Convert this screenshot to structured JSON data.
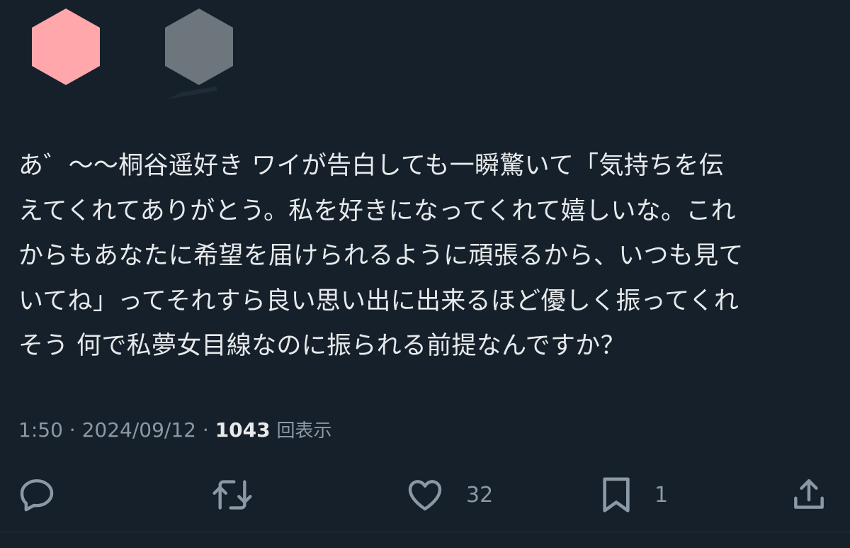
{
  "avatars": {
    "first_color": "#ffa7ab",
    "second_color": "#6e767d"
  },
  "tweet": {
    "lines": [
      "あ゛〜〜桐谷遥好き ワイが告白しても一瞬驚いて「気持ちを伝",
      "えてくれてありがとう。私を好きになってくれて嬉しいな。これ",
      "からもあなたに希望を届けられるように頑張るから、いつも見て",
      "いてね」ってそれすら良い思い出に出来るほど優しく振ってくれ",
      "そう 何で私夢女目線なのに振られる前提なんですか？"
    ]
  },
  "meta": {
    "time": "1:50",
    "separator": " · ",
    "date": "2024/09/12",
    "views_count": "1043",
    "views_label": "回表示"
  },
  "actions": {
    "reply_icon": "reply-icon",
    "retweet_icon": "retweet-icon",
    "like_icon": "heart-icon",
    "like_count": "32",
    "bookmark_icon": "bookmark-icon",
    "bookmark_count": "1",
    "share_icon": "share-icon"
  },
  "colors": {
    "background": "#15202b",
    "text": "#e7e9ea",
    "secondary": "#8b98a5"
  }
}
